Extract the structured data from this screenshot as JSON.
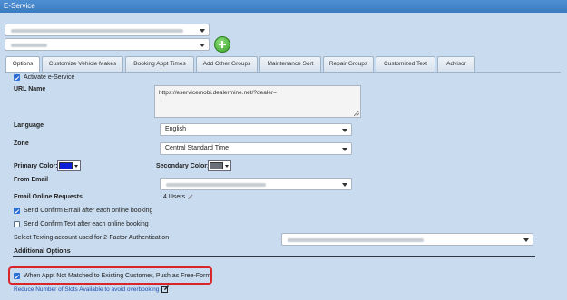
{
  "window": {
    "title": "E-Service"
  },
  "dealer_select_1": {
    "value": ""
  },
  "dealer_select_2": {
    "value": ""
  },
  "tabs": [
    {
      "label": "Options",
      "active": true
    },
    {
      "label": "Customize Vehicle Makes"
    },
    {
      "label": "Booking Appt Times"
    },
    {
      "label": "Add Other Groups"
    },
    {
      "label": "Maintenance Sort"
    },
    {
      "label": "Repair Groups"
    },
    {
      "label": "Customized Text"
    },
    {
      "label": "Advisor"
    }
  ],
  "options": {
    "activate_label": "Activate e-Service",
    "activate_checked": true,
    "url_label": "URL Name",
    "url_value": "https://eservicemobi.dealermine.net/?dealer=",
    "language_label": "Language",
    "language_value": "English",
    "zone_label": "Zone",
    "zone_value": "Central Standard Time",
    "primary_color_label": "Primary Color:",
    "primary_color": "#0a1fd6",
    "secondary_color_label": "Secondary Color:",
    "secondary_color": "#6b7078",
    "from_email_label": "From Email",
    "email_requests_label": "Email Online Requests",
    "email_requests_value": "4 Users",
    "send_confirm_email_label": "Send Confirm Email after each online booking",
    "send_confirm_email_checked": true,
    "send_confirm_text_label": "Send Confirm Text after each online booking",
    "send_confirm_text_checked": false,
    "texting_account_label": "Select Texting account used for 2-Factor Authentication",
    "additional_options_label": "Additional Options",
    "push_free_form_label": "When Appt Not Matched to Existing Customer, Push as Free-Form",
    "push_free_form_checked": true,
    "reduce_slots_link": "Reduce Number of Slots Available to avoid overbooking"
  },
  "colors": {
    "titlebar": "#3b7cc1",
    "highlight": "#d9262a",
    "add_button": "#3aa02a",
    "link": "#1f4fb0"
  }
}
